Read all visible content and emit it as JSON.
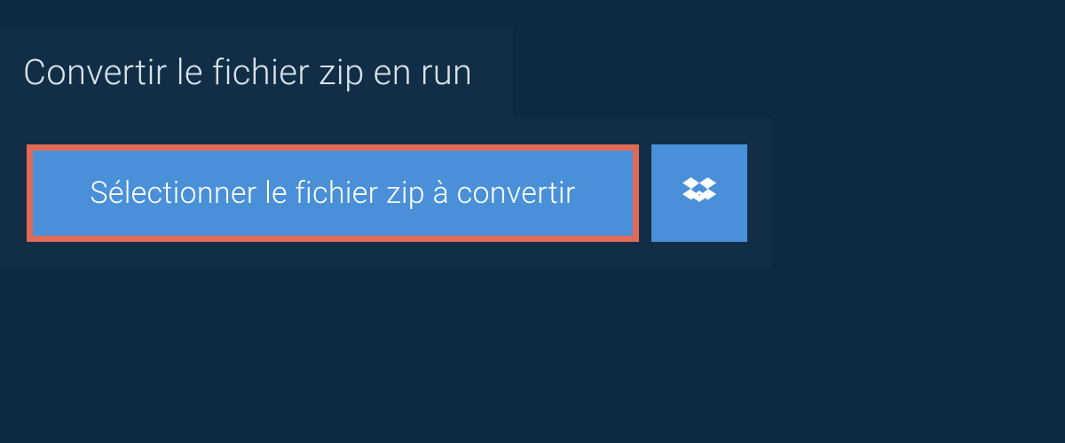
{
  "tab": {
    "title": "Convertir le fichier zip en run"
  },
  "panel": {
    "select_button_label": "Sélectionner le fichier zip à convertir"
  },
  "colors": {
    "background": "#0d2a42",
    "panel": "#112e46",
    "button": "#4a90d9",
    "highlight_border": "#e16a57",
    "text_light": "#dbe4ea"
  }
}
